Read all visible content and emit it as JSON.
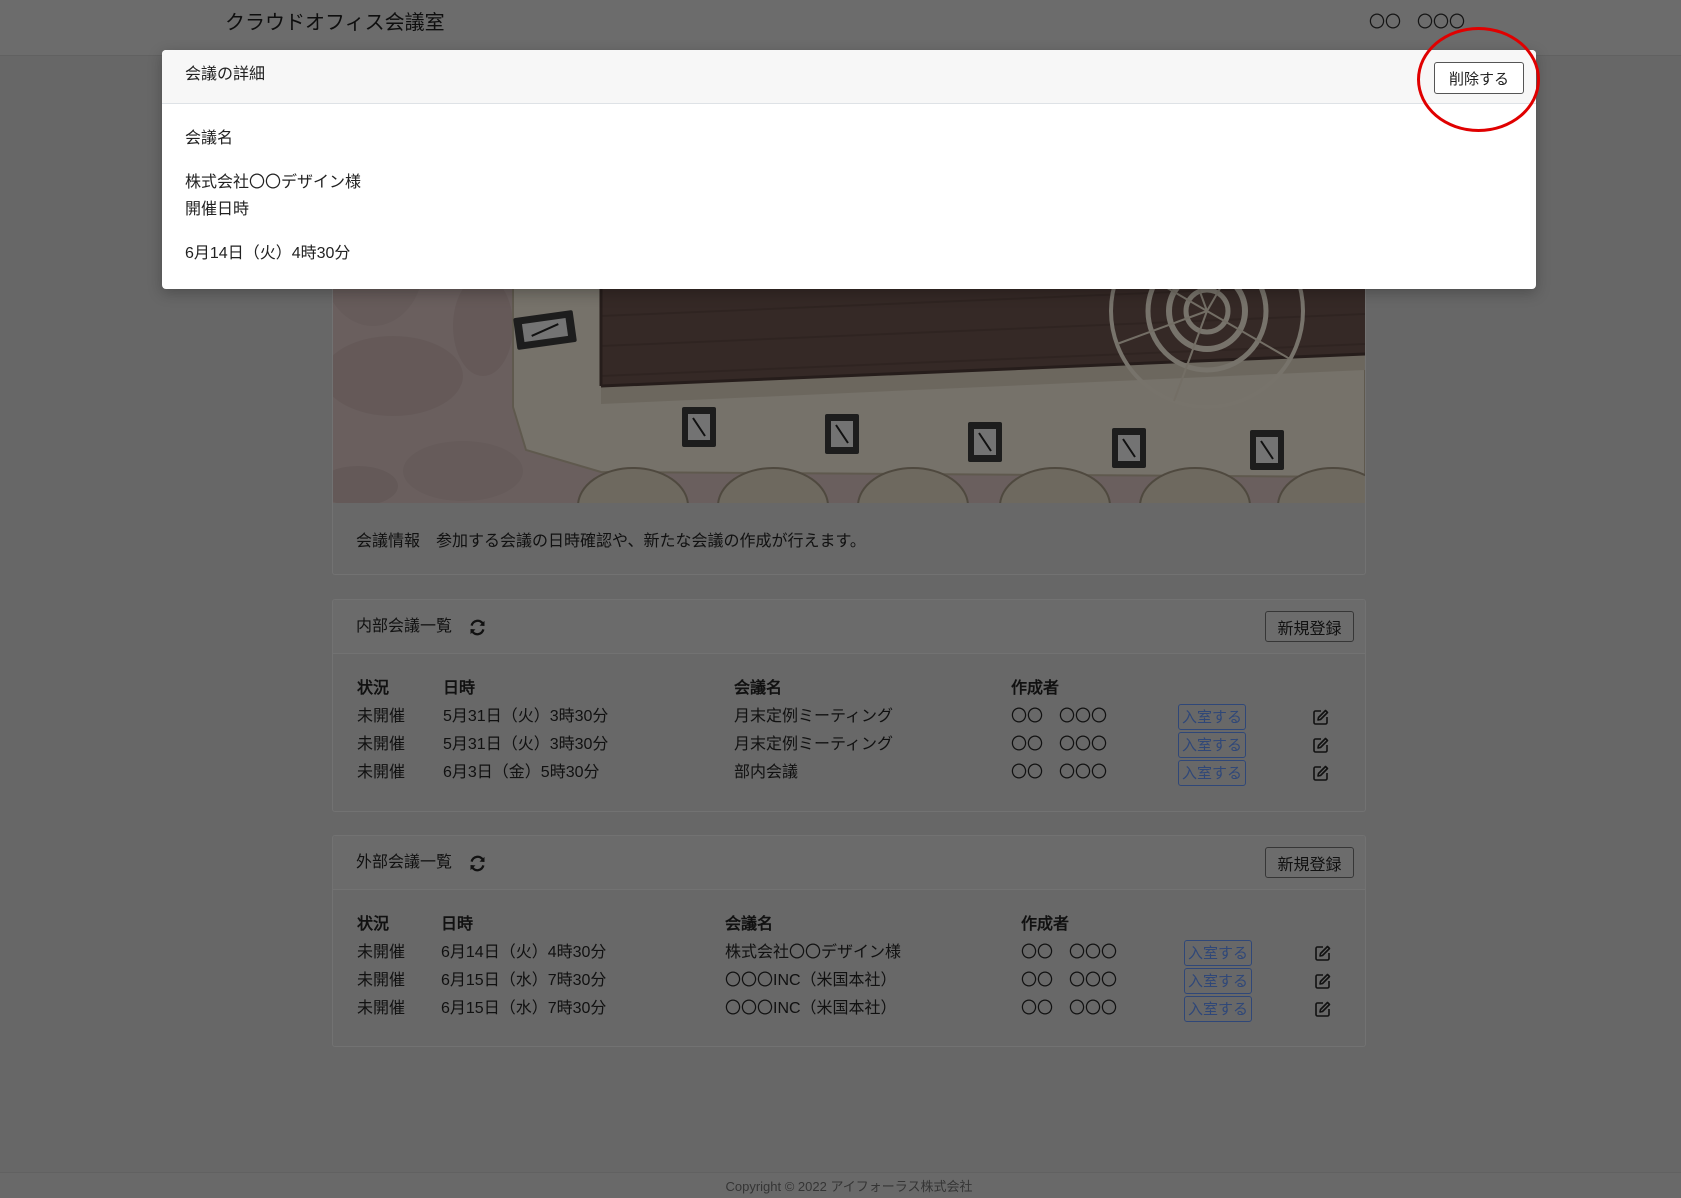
{
  "app": {
    "title": "クラウドオフィス会議室",
    "user_name": "〇〇　〇〇〇"
  },
  "modal": {
    "title": "会議の詳細",
    "delete_label": "削除する",
    "meeting_name_label": "会議名",
    "meeting_name_value": "株式会社〇〇デザイン様",
    "datetime_label": "開催日時",
    "datetime_value": "6月14日（火）4時30分"
  },
  "info": {
    "label": "会議情報",
    "description": "参加する会議の日時確認や、新たな会議の作成が行えます。"
  },
  "internal": {
    "title": "内部会議一覧",
    "new_label": "新規登録",
    "enter_label": "入室する",
    "columns": [
      "状況",
      "日時",
      "会議名",
      "作成者"
    ],
    "rows": [
      {
        "status": "未開催",
        "datetime": "5月31日（火）3時30分",
        "name": "月末定例ミーティング",
        "creator": "〇〇　〇〇〇"
      },
      {
        "status": "未開催",
        "datetime": "5月31日（火）3時30分",
        "name": "月末定例ミーティング",
        "creator": "〇〇　〇〇〇"
      },
      {
        "status": "未開催",
        "datetime": "6月3日（金）5時30分",
        "name": "部内会議",
        "creator": "〇〇　〇〇〇"
      }
    ]
  },
  "external": {
    "title": "外部会議一覧",
    "new_label": "新規登録",
    "enter_label": "入室する",
    "columns": [
      "状況",
      "日時",
      "会議名",
      "作成者"
    ],
    "rows": [
      {
        "status": "未開催",
        "datetime": "6月14日（火）4時30分",
        "name": "株式会社〇〇デザイン様",
        "creator": "〇〇　〇〇〇"
      },
      {
        "status": "未開催",
        "datetime": "6月15日（水）7時30分",
        "name": "〇〇〇INC（米国本社）",
        "creator": "〇〇　〇〇〇"
      },
      {
        "status": "未開催",
        "datetime": "6月15日（水）7時30分",
        "name": "〇〇〇INC（米国本社）",
        "creator": "〇〇　〇〇〇"
      }
    ]
  },
  "footer": {
    "copyright": "Copyright © 2022 アイフォーラス株式会社"
  },
  "icons": {
    "refresh": "refresh-icon",
    "edit": "edit-icon"
  },
  "colors": {
    "accent": "#5f8ff0",
    "highlight": "#e00000"
  }
}
